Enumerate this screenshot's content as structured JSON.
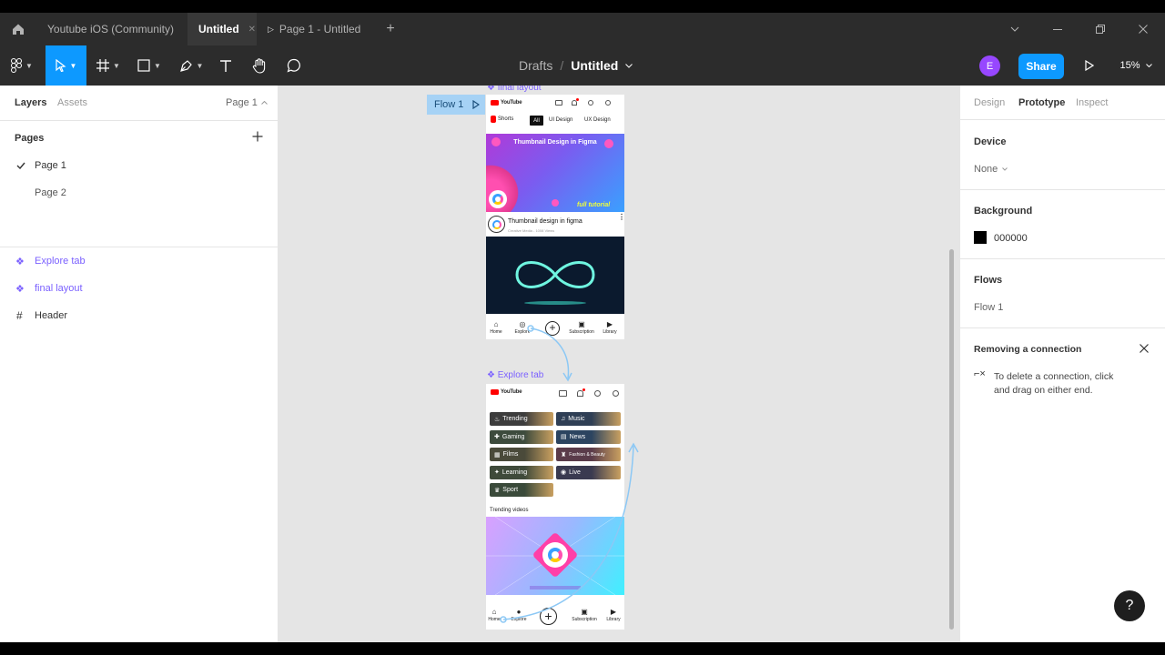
{
  "tabs": [
    {
      "label": "Youtube iOS (Community)"
    },
    {
      "label": "Untitled",
      "close": "✕"
    },
    {
      "label": "Page 1 - Untitled"
    }
  ],
  "toolbar": {
    "breadcrumb_parent": "Drafts",
    "breadcrumb_sep": "/",
    "file_name": "Untitled",
    "avatar_initial": "E",
    "share_label": "Share",
    "zoom": "15%"
  },
  "left_panel": {
    "tab_layers": "Layers",
    "tab_assets": "Assets",
    "page_selector": "Page 1",
    "pages_heading": "Pages",
    "pages": [
      "Page 1",
      "Page 2"
    ],
    "layers": [
      {
        "name": "Explore tab",
        "type": "component"
      },
      {
        "name": "final layout",
        "type": "component"
      },
      {
        "name": "Header",
        "type": "frame"
      }
    ]
  },
  "canvas": {
    "flow_label": "Flow 1",
    "frame1_label": "final layout",
    "frame2_label": "Explore tab",
    "frame1": {
      "logo": "YouTube",
      "chips": [
        "Shorts",
        "All",
        "UI Design",
        "UX Design"
      ],
      "banner_title": "Thumbnail Design in Figma",
      "banner_tag": "full tutorial",
      "video_title": "Thumbnail design in figma",
      "video_meta": "Creative Media - 1008 Views",
      "nav": [
        "Home",
        "Explore",
        "Subscription",
        "Library"
      ]
    },
    "frame2": {
      "logo": "YouTube",
      "categories": [
        {
          "label": "Trending",
          "icon": "fire-icon",
          "color": "#3d3d3d"
        },
        {
          "label": "Music",
          "icon": "music-icon",
          "color": "#2f3f55"
        },
        {
          "label": "Gaming",
          "icon": "gamepad-icon",
          "color": "#3d4b3d"
        },
        {
          "label": "News",
          "icon": "news-icon",
          "color": "#2c4460"
        },
        {
          "label": "Films",
          "icon": "film-icon",
          "color": "#4a4a3a"
        },
        {
          "label": "Fashion & Beauty",
          "icon": "hanger-icon",
          "color": "#5a3b4a"
        },
        {
          "label": "Learning",
          "icon": "bulb-icon",
          "color": "#3f4a3a"
        },
        {
          "label": "Live",
          "icon": "live-icon",
          "color": "#3a3a50"
        },
        {
          "label": "Sport",
          "icon": "trophy-icon",
          "color": "#3a4a3a"
        }
      ],
      "section_title": "Trending videos",
      "nav": [
        "Home",
        "Explore",
        "Subscription",
        "Library"
      ]
    }
  },
  "right_panel": {
    "tabs": [
      "Design",
      "Prototype",
      "Inspect"
    ],
    "device_label": "Device",
    "device_value": "None",
    "background_label": "Background",
    "background_value": "000000",
    "background_color": "#000000",
    "flows_label": "Flows",
    "flows_value": "Flow 1",
    "hint_title": "Removing a connection",
    "hint_text": "To delete a connection, click and drag on either end."
  },
  "colors": {
    "accent": "#0d99ff",
    "component": "#7b61ff",
    "avatar": "#9747ff"
  },
  "help_label": "?"
}
